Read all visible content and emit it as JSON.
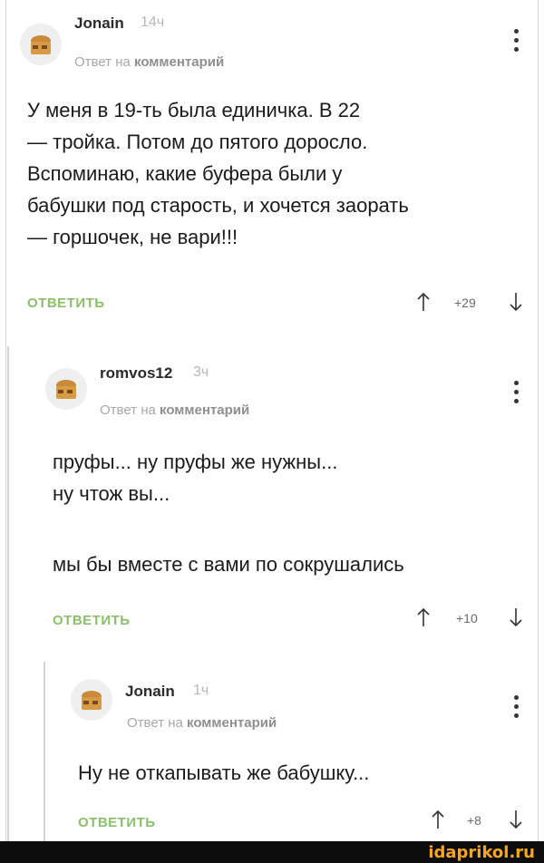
{
  "comments": [
    {
      "username": "Jonain",
      "time": "14ч",
      "reply_prefix": "Ответ на",
      "reply_target": "комментарий",
      "lines": [
        "У меня в 19-ть была единичка. В 22",
        "— тройка. Потом до пятого доросло.",
        "Вспоминаю, какие буфера были у",
        "бабушки под старость, и хочется заорать",
        "— горшочек, не вари!!!"
      ],
      "reply_label": "ОТВЕТИТЬ",
      "rating": "+29"
    },
    {
      "username": "romvos12",
      "time": "3ч",
      "reply_prefix": "Ответ на",
      "reply_target": "комментарий",
      "lines": [
        "пруфы... ну пруфы же нужны...",
        "ну чтож вы...",
        "",
        "мы бы вместе с вами по сокрушались"
      ],
      "reply_label": "ОТВЕТИТЬ",
      "rating": "+10"
    },
    {
      "username": "Jonain",
      "time": "1ч",
      "reply_prefix": "Ответ на",
      "reply_target": "комментарий",
      "lines": [
        "Ну не откапывать же бабушку..."
      ],
      "reply_label": "ОТВЕТИТЬ",
      "rating": "+8"
    }
  ],
  "watermark": "idaprikol.ru",
  "colors": {
    "reply_button": "#8bbf6a",
    "watermark": "#f5a623"
  },
  "icons": [
    "more-icon",
    "arrow-up-icon",
    "arrow-down-icon",
    "avatar-icon"
  ]
}
